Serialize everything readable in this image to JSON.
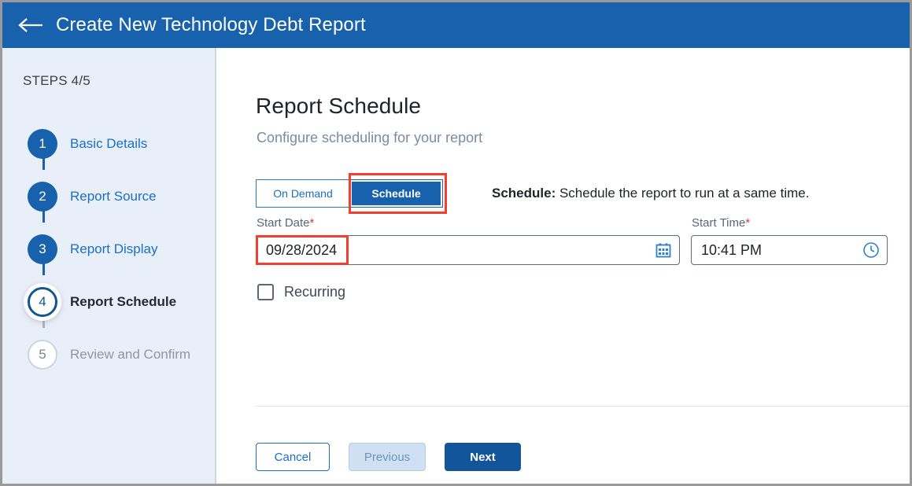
{
  "header": {
    "back_icon": "back-arrow-icon",
    "title": "Create New Technology Debt Report"
  },
  "sidebar": {
    "steps_label": "STEPS 4/5",
    "steps": [
      {
        "number": "1",
        "label": "Basic Details",
        "state": "done"
      },
      {
        "number": "2",
        "label": "Report Source",
        "state": "done"
      },
      {
        "number": "3",
        "label": "Report Display",
        "state": "done"
      },
      {
        "number": "4",
        "label": "Report Schedule",
        "state": "active"
      },
      {
        "number": "5",
        "label": "Review and Confirm",
        "state": "todo"
      }
    ]
  },
  "main": {
    "title": "Report Schedule",
    "subtitle": "Configure scheduling for your report",
    "mode_toggle": {
      "on_demand_label": "On Demand",
      "schedule_label": "Schedule",
      "selected": "Schedule"
    },
    "mode_description": {
      "term": "Schedule:",
      "text": " Schedule the report to run at a same time."
    },
    "start_date": {
      "label": "Start Date",
      "required_marker": "*",
      "value": "09/28/2024",
      "placeholder": "MM/DD/YYYY",
      "icon": "calendar-icon"
    },
    "start_time": {
      "label": "Start Time",
      "required_marker": "*",
      "value": "10:41 PM",
      "placeholder": "hh:mm AM/PM",
      "icon": "clock-icon"
    },
    "recurring": {
      "label": "Recurring",
      "checked": false
    },
    "footer": {
      "cancel_label": "Cancel",
      "previous_label": "Previous",
      "next_label": "Next"
    }
  },
  "colors": {
    "header_blue": "#1761ad",
    "primary_blue": "#12559a",
    "link_blue": "#1a6fc4",
    "sidebar_bg": "#e9eff8",
    "annotation_red": "#f23f32",
    "required_red": "#e53935"
  }
}
